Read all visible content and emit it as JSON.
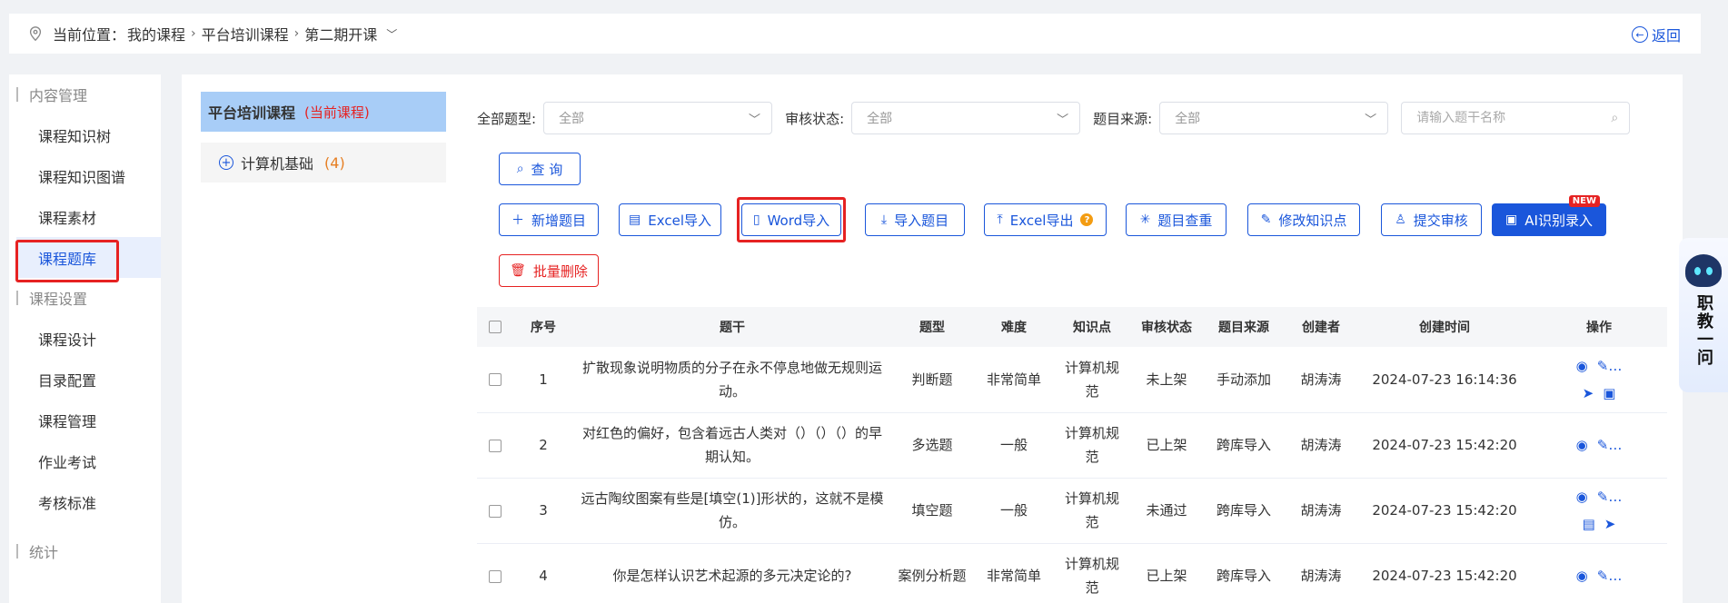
{
  "breadcrumb": {
    "prefix": "当前位置：",
    "items": [
      "我的课程",
      "平台培训课程",
      "第二期开课"
    ]
  },
  "back_label": "返回",
  "sidebar": {
    "groups": [
      {
        "title": "内容管理",
        "items": [
          "课程知识树",
          "课程知识图谱",
          "课程素材",
          "课程题库"
        ]
      },
      {
        "title": "课程设置",
        "items": [
          "课程设计",
          "目录配置",
          "课程管理",
          "作业考试",
          "考核标准"
        ]
      },
      {
        "title": "统计",
        "items": []
      }
    ],
    "active": "课程题库"
  },
  "tree": {
    "title": "平台培训课程",
    "current_tag": "(当前课程)",
    "nodes": [
      {
        "label": "计算机基础",
        "count": "(4)"
      }
    ]
  },
  "filters": {
    "type_label": "全部题型:",
    "type_value": "全部",
    "status_label": "审核状态:",
    "status_value": "全部",
    "source_label": "题目来源:",
    "source_value": "全部",
    "search_placeholder": "请输入题干名称"
  },
  "buttons": {
    "query": "查 询",
    "add": "新增题目",
    "excel_import": "Excel导入",
    "word_import": "Word导入",
    "import_questions": "导入题目",
    "excel_export": "Excel导出",
    "dup_check": "题目查重",
    "modify_kp": "修改知识点",
    "submit_review": "提交审核",
    "ai_import": "AI识别录入",
    "new_badge": "NEW",
    "batch_delete": "批量删除"
  },
  "table": {
    "headers": [
      "序号",
      "题干",
      "题型",
      "难度",
      "知识点",
      "审核状态",
      "题目来源",
      "创建者",
      "创建时间",
      "操作"
    ],
    "rows": [
      {
        "no": "1",
        "stem": "扩散现象说明物质的分子在永不停息地做无规则运动。",
        "type": "判断题",
        "difficulty": "非常简单",
        "kp": "计算机规范",
        "status": "未上架",
        "source": "手动添加",
        "creator": "胡涛涛",
        "time": "2024-07-23 16:14:36"
      },
      {
        "no": "2",
        "stem": "对红色的偏好，包含着远古人类对（）（）（）的早期认知。",
        "type": "多选题",
        "difficulty": "一般",
        "kp": "计算机规范",
        "status": "已上架",
        "source": "跨库导入",
        "creator": "胡涛涛",
        "time": "2024-07-23 15:42:20"
      },
      {
        "no": "3",
        "stem": "远古陶纹图案有些是[填空(1)]形状的，这就不是模仿。",
        "type": "填空题",
        "difficulty": "一般",
        "kp": "计算机规范",
        "status": "未通过",
        "source": "跨库导入",
        "creator": "胡涛涛",
        "time": "2024-07-23 15:42:20"
      },
      {
        "no": "4",
        "stem": "你是怎样认识艺术起源的多元决定论的?",
        "type": "案例分析题",
        "difficulty": "非常简单",
        "kp": "计算机规范",
        "status": "已上架",
        "source": "跨库导入",
        "creator": "胡涛涛",
        "time": "2024-07-23 15:42:20"
      }
    ]
  },
  "assistant": {
    "label": "职教一问"
  }
}
